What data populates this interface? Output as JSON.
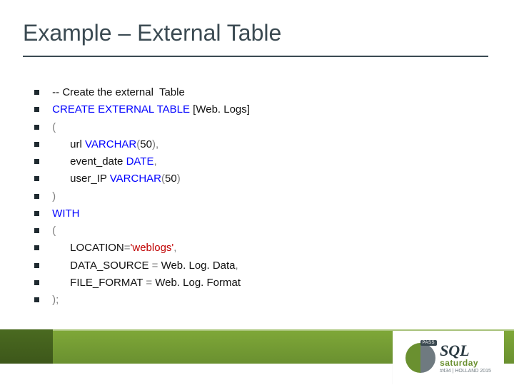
{
  "title": "Example – External Table",
  "code": {
    "l1": " -- Create the external  Table",
    "l2a": " CREATE EXTERNAL TABLE",
    "l2b": " [Web. Logs]",
    "l3": " (",
    "l4a": "       url ",
    "l4b": "VARCHAR",
    "l4c": "(",
    "l4d": "50",
    "l4e": ")",
    "l4f": ",",
    "l5a": "       event_date ",
    "l5b": "DATE",
    "l5c": ",",
    "l6a": "       user_IP ",
    "l6b": "VARCHAR",
    "l6c": "(",
    "l6d": "50",
    "l6e": ")",
    "l7": " )",
    "l8": " WITH",
    "l9": " (",
    "l10a": "       LOCATION",
    "l10b": "=",
    "l10c": "'weblogs'",
    "l10d": ",",
    "l11a": "       DATA_SOURCE ",
    "l11b": "=",
    "l11c": " Web. Log. Data",
    "l11d": ",",
    "l12a": "       FILE_FORMAT ",
    "l12b": "=",
    "l12c": " Web. Log. Format",
    "l13": " );"
  },
  "logo": {
    "badge": "PASS",
    "line1": "SQL",
    "line2": "saturday",
    "sub": "#434 | HOLLAND 2015"
  }
}
